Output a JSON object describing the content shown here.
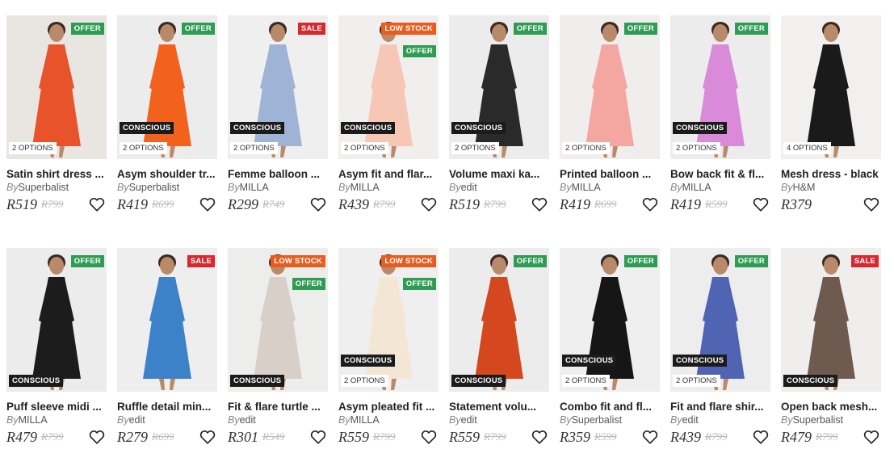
{
  "by_label": "By",
  "rows": [
    [
      {
        "name": "Satin shirt dress ...",
        "brand": "Superbalist",
        "price": "R519",
        "was": "R799",
        "badge_top": "OFFER",
        "badge_top2": "",
        "conscious": "",
        "options": "2 OPTIONS",
        "dress": "#e8532b",
        "bg": "#e9e6e2"
      },
      {
        "name": "Asym shoulder tr...",
        "brand": "Superbalist",
        "price": "R419",
        "was": "R699",
        "badge_top": "OFFER",
        "badge_top2": "",
        "conscious": "CONSCIOUS",
        "options": "2 OPTIONS",
        "dress": "#f2621c",
        "bg": "#ececec"
      },
      {
        "name": "Femme balloon ...",
        "brand": "MILLA",
        "price": "R299",
        "was": "R749",
        "badge_top": "SALE",
        "badge_top2": "",
        "conscious": "CONSCIOUS",
        "options": "2 OPTIONS",
        "dress": "#9fb3d6",
        "bg": "#efefef"
      },
      {
        "name": "Asym fit and flar...",
        "brand": "MILLA",
        "price": "R439",
        "was": "R799",
        "badge_top": "LOW STOCK",
        "badge_top2": "OFFER",
        "conscious": "CONSCIOUS",
        "options": "2 OPTIONS",
        "dress": "#f6c7b5",
        "bg": "#f0efee"
      },
      {
        "name": "Volume maxi ka...",
        "brand": "edit",
        "price": "R519",
        "was": "R799",
        "badge_top": "OFFER",
        "badge_top2": "",
        "conscious": "CONSCIOUS",
        "options": "2 OPTIONS",
        "dress": "#2a2a2a",
        "bg": "#ececec"
      },
      {
        "name": "Printed balloon ...",
        "brand": "MILLA",
        "price": "R419",
        "was": "R699",
        "badge_top": "OFFER",
        "badge_top2": "",
        "conscious": "",
        "options": "2 OPTIONS",
        "dress": "#f4a7a0",
        "bg": "#efeeed"
      },
      {
        "name": "Bow back fit & fl...",
        "brand": "MILLA",
        "price": "R419",
        "was": "R599",
        "badge_top": "OFFER",
        "badge_top2": "",
        "conscious": "CONSCIOUS",
        "options": "2 OPTIONS",
        "dress": "#d98ad8",
        "bg": "#ececec"
      },
      {
        "name": "Mesh dress - black",
        "brand": "H&M",
        "price": "R379",
        "was": "",
        "badge_top": "",
        "badge_top2": "",
        "conscious": "",
        "options": "4 OPTIONS",
        "dress": "#1a1a1a",
        "bg": "#f1f0ee"
      }
    ],
    [
      {
        "name": "Puff sleeve midi ...",
        "brand": "MILLA",
        "price": "R479",
        "was": "R799",
        "badge_top": "OFFER",
        "badge_top2": "",
        "conscious": "CONSCIOUS",
        "options": "",
        "dress": "#1c1c1c",
        "bg": "#ececec"
      },
      {
        "name": "Ruffle detail min...",
        "brand": "edit",
        "price": "R279",
        "was": "R699",
        "badge_top": "SALE",
        "badge_top2": "",
        "conscious": "",
        "options": "",
        "dress": "#3d82c8",
        "bg": "#eeeeee"
      },
      {
        "name": "Fit & flare turtle ...",
        "brand": "edit",
        "price": "R301",
        "was": "R549",
        "badge_top": "LOW STOCK",
        "badge_top2": "OFFER",
        "conscious": "CONSCIOUS",
        "options": "",
        "dress": "#d8cfc8",
        "bg": "#ededec"
      },
      {
        "name": "Asym pleated fit ...",
        "brand": "MILLA",
        "price": "R559",
        "was": "R799",
        "badge_top": "LOW STOCK",
        "badge_top2": "OFFER",
        "conscious": "CONSCIOUS",
        "options": "2 OPTIONS",
        "dress": "#f3e6d4",
        "bg": "#efefef"
      },
      {
        "name": "Statement volu...",
        "brand": "edit",
        "price": "R559",
        "was": "R799",
        "badge_top": "OFFER",
        "badge_top2": "",
        "conscious": "CONSCIOUS",
        "options": "",
        "dress": "#d4471f",
        "bg": "#ececec"
      },
      {
        "name": "Combo fit and fl...",
        "brand": "Superbalist",
        "price": "R359",
        "was": "R599",
        "badge_top": "OFFER",
        "badge_top2": "",
        "conscious": "CONSCIOUS",
        "options": "2 OPTIONS",
        "dress": "#161616",
        "bg": "#efefef"
      },
      {
        "name": "Fit and flare shir...",
        "brand": "edit",
        "price": "R439",
        "was": "R799",
        "badge_top": "OFFER",
        "badge_top2": "",
        "conscious": "CONSCIOUS",
        "options": "2 OPTIONS",
        "dress": "#4f64b3",
        "bg": "#ededed"
      },
      {
        "name": "Open back mesh...",
        "brand": "Superbalist",
        "price": "R479",
        "was": "R799",
        "badge_top": "SALE",
        "badge_top2": "",
        "conscious": "CONSCIOUS",
        "options": "",
        "dress": "#6e5a4e",
        "bg": "#efeeed"
      }
    ]
  ],
  "colors": {
    "offer": "#2e9c52",
    "sale": "#d9272e",
    "low_stock": "#e85d1e",
    "conscious": "#1b1b1b"
  },
  "icons": {
    "wishlist": "heart-icon"
  }
}
